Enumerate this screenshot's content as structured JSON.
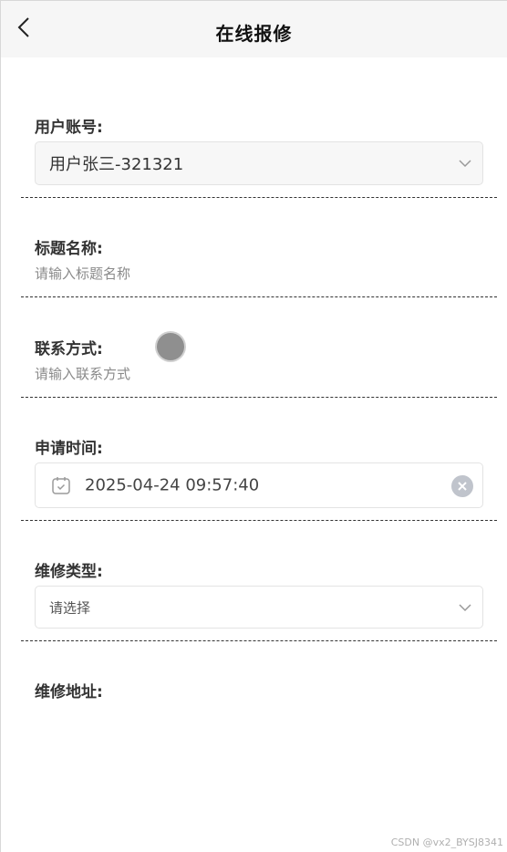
{
  "header": {
    "title": "在线报修"
  },
  "form": {
    "user_account": {
      "label": "用户账号:",
      "value": "用户张三-321321"
    },
    "title_name": {
      "label": "标题名称:",
      "placeholder": "请输入标题名称"
    },
    "contact": {
      "label": "联系方式:",
      "placeholder": "请输入联系方式"
    },
    "apply_time": {
      "label": "申请时间:",
      "value": "2025-04-24 09:57:40"
    },
    "repair_type": {
      "label": "维修类型:",
      "placeholder": "请选择"
    },
    "repair_address": {
      "label": "维修地址:"
    }
  },
  "watermark": "CSDN @vx2_BYSJ8341",
  "icons": [
    "back-arrow-icon",
    "chevron-down-icon",
    "calendar-icon",
    "clear-icon"
  ]
}
